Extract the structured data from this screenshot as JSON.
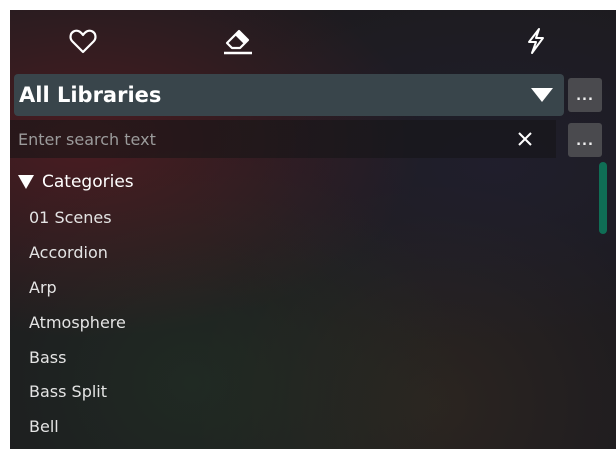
{
  "toolbar": {
    "icons": [
      "heart-icon",
      "eraser-icon",
      "lightning-icon"
    ]
  },
  "library_select": {
    "label": "All Libraries",
    "more_label": "..."
  },
  "search": {
    "placeholder": "Enter search text",
    "value": "",
    "clear_label": "×",
    "more_label": "..."
  },
  "categories": {
    "header": "Categories",
    "expanded": true,
    "items": [
      "01 Scenes",
      "Accordion",
      "Arp",
      "Atmosphere",
      "Bass",
      "Bass Split",
      "Bell"
    ]
  },
  "colors": {
    "accent_scrollbar": "#0f6e55",
    "select_bg": "#39454b",
    "panel_bg": "#1d1b1f"
  }
}
